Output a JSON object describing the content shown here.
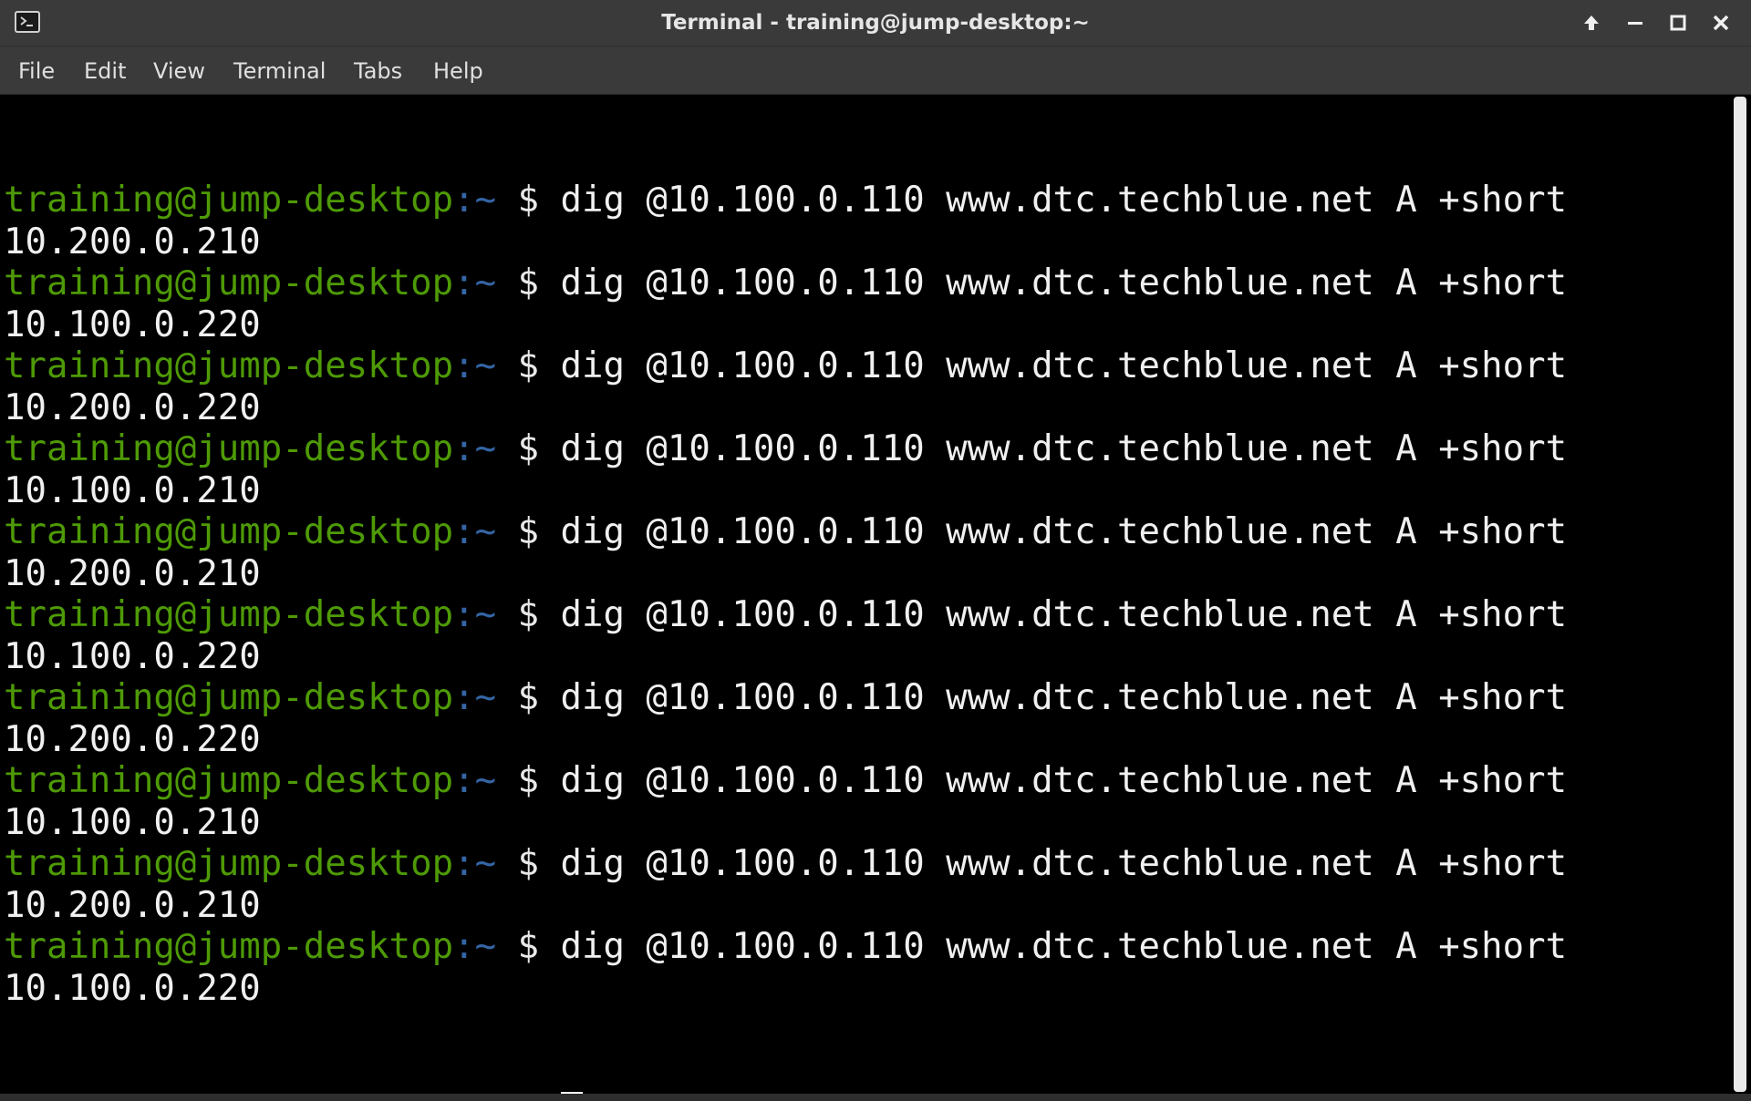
{
  "window": {
    "title": "Terminal - training@jump-desktop:~",
    "icons": {
      "app": "terminal-icon",
      "maximize_up": "arrow-up-icon",
      "minimize": "minimize-icon",
      "maximize": "maximize-icon",
      "close": "close-icon"
    }
  },
  "menu": {
    "file": "File",
    "edit": "Edit",
    "view": "View",
    "terminal": "Terminal",
    "tabs": "Tabs",
    "help": "Help"
  },
  "prompt": {
    "user_host": "training@jump-desktop",
    "path": ":~",
    "symbol": " $ "
  },
  "session": [
    {
      "command": "dig @10.100.0.110 www.dtc.techblue.net A +short",
      "output": "10.200.0.210"
    },
    {
      "command": "dig @10.100.0.110 www.dtc.techblue.net A +short",
      "output": "10.100.0.220"
    },
    {
      "command": "dig @10.100.0.110 www.dtc.techblue.net A +short",
      "output": "10.200.0.220"
    },
    {
      "command": "dig @10.100.0.110 www.dtc.techblue.net A +short",
      "output": "10.100.0.210"
    },
    {
      "command": "dig @10.100.0.110 www.dtc.techblue.net A +short",
      "output": "10.200.0.210"
    },
    {
      "command": "dig @10.100.0.110 www.dtc.techblue.net A +short",
      "output": "10.100.0.220"
    },
    {
      "command": "dig @10.100.0.110 www.dtc.techblue.net A +short",
      "output": "10.200.0.220"
    },
    {
      "command": "dig @10.100.0.110 www.dtc.techblue.net A +short",
      "output": "10.100.0.210"
    },
    {
      "command": "dig @10.100.0.110 www.dtc.techblue.net A +short",
      "output": "10.200.0.210"
    },
    {
      "command": "dig @10.100.0.110 www.dtc.techblue.net A +short",
      "output": "10.100.0.220"
    }
  ],
  "colors": {
    "prompt_user": "#4e9a06",
    "prompt_path": "#3465a4",
    "text": "#f0f0f0",
    "background": "#000000",
    "chrome": "#3a3a3a"
  }
}
